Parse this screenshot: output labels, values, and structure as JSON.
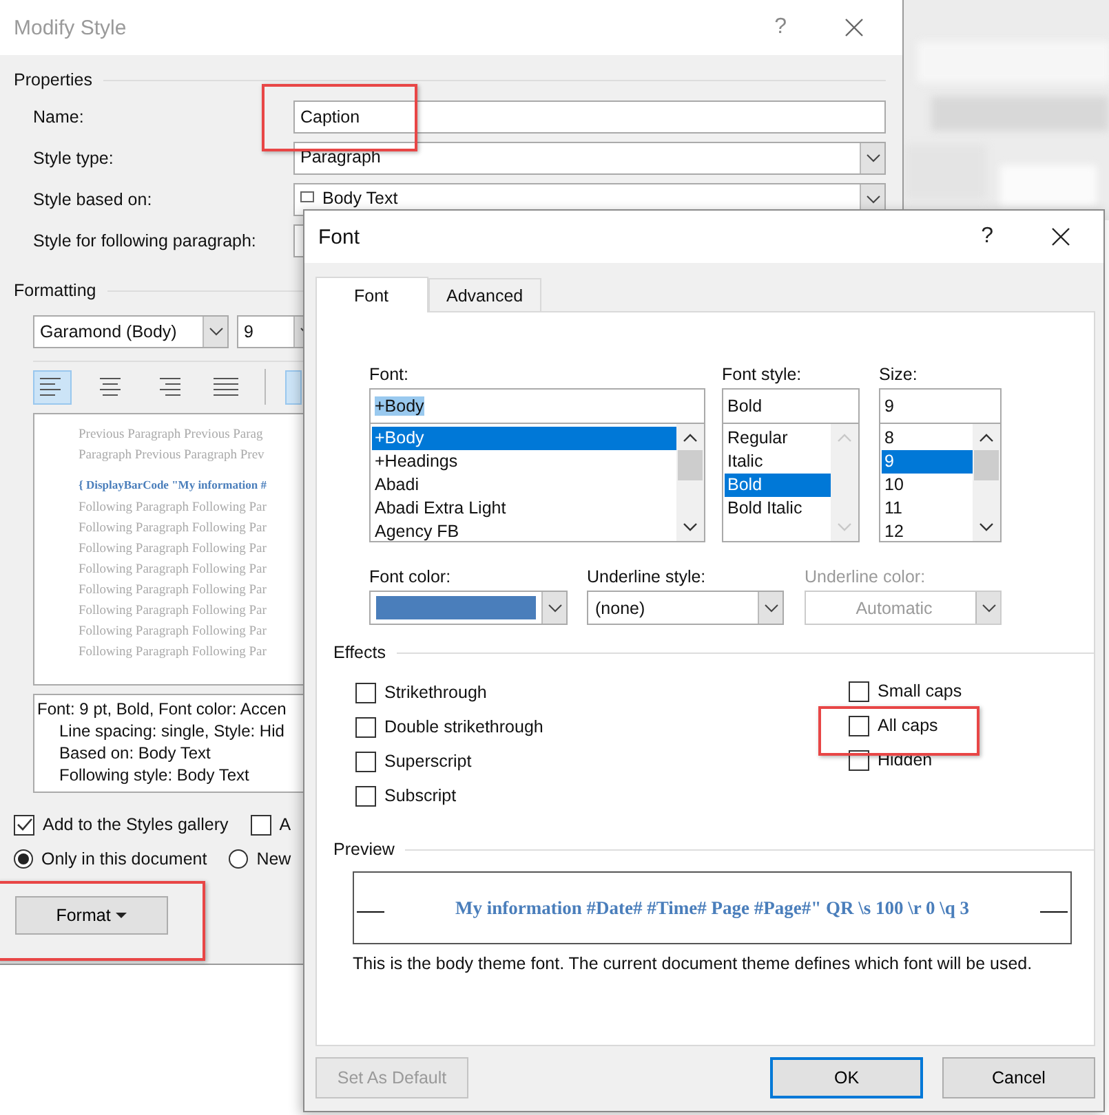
{
  "modify_style": {
    "title": "Modify Style",
    "help": "?",
    "properties": {
      "label": "Properties",
      "fields": [
        {
          "label": "Name:",
          "kind": "text",
          "value": "Caption"
        },
        {
          "label": "Style type:",
          "kind": "dropdown",
          "value": "Paragraph"
        },
        {
          "label": "Style based on:",
          "kind": "dropdown",
          "value": "Body Text"
        },
        {
          "label": "Style for following paragraph:",
          "kind": "dropdown"
        }
      ]
    },
    "formatting": {
      "label": "Formatting",
      "font": "Garamond (Body)",
      "size": "9",
      "align_buttons": [
        {
          "kind": "left",
          "selected": true
        },
        {
          "kind": "center",
          "selected": false
        },
        {
          "kind": "right",
          "selected": false
        },
        {
          "kind": "justify",
          "selected": false
        },
        {
          "kind": "cut",
          "selected": true
        }
      ]
    },
    "preview": {
      "previous_lines": [
        "Previous Paragraph Previous Parag",
        "Paragraph Previous Paragraph Prev"
      ],
      "sample": "{ DisplayBarCode \"My information #",
      "following_lines": [
        "Following Paragraph Following Par",
        "Following Paragraph Following Par",
        "Following Paragraph Following Par",
        "Following Paragraph Following Par",
        "Following Paragraph Following Par",
        "Following Paragraph Following Par",
        "Following Paragraph Following Par",
        "Following Paragraph Following Par"
      ]
    },
    "description_lines": [
      {
        "text": "Font: 9 pt, Bold, Font color: Accen",
        "indent": false
      },
      {
        "text": "Line spacing:  single, Style: Hid",
        "indent": true
      },
      {
        "text": "Based on: Body Text",
        "indent": true
      },
      {
        "text": "Following style: Body Text",
        "indent": true
      }
    ],
    "checkboxes": [
      {
        "label": "Add to the Styles gallery",
        "checked": true
      },
      {
        "label": "A",
        "checked": false
      }
    ],
    "scope": [
      {
        "label": "Only in this document",
        "selected": true
      },
      {
        "label": "New",
        "selected": false
      }
    ],
    "format_button": "Format"
  },
  "font_dialog": {
    "title": "Font",
    "help": "?",
    "tabs": [
      {
        "label": "Font",
        "selected": true
      },
      {
        "label": "Advanced",
        "selected": false
      }
    ],
    "font": {
      "label": "Font:",
      "value": "+Body",
      "items": [
        {
          "label": "+Body",
          "selected": true
        },
        {
          "label": "+Headings",
          "selected": false
        },
        {
          "label": "Abadi",
          "selected": false
        },
        {
          "label": "Abadi Extra Light",
          "selected": false
        },
        {
          "label": "Agency FB",
          "selected": false
        }
      ]
    },
    "font_style": {
      "label": "Font style:",
      "value": "Bold",
      "items": [
        {
          "label": "Regular",
          "selected": false
        },
        {
          "label": "Italic",
          "selected": false
        },
        {
          "label": "Bold",
          "selected": true
        },
        {
          "label": "Bold Italic",
          "selected": false
        }
      ]
    },
    "size": {
      "label": "Size:",
      "value": "9",
      "items": [
        {
          "label": "8",
          "selected": false
        },
        {
          "label": "9",
          "selected": true
        },
        {
          "label": "10",
          "selected": false
        },
        {
          "label": "11",
          "selected": false
        },
        {
          "label": "12",
          "selected": false
        }
      ]
    },
    "font_color": {
      "label": "Font color:",
      "color": "#4a7ebb"
    },
    "underline_style": {
      "label": "Underline style:",
      "value": "(none)",
      "disabled": false
    },
    "underline_color": {
      "label": "Underline color:",
      "value": "Automatic",
      "disabled": true
    },
    "effects": {
      "label": "Effects",
      "left": [
        {
          "label": "Strikethrough",
          "checked": false
        },
        {
          "label": "Double strikethrough",
          "checked": false
        },
        {
          "label": "Superscript",
          "checked": false
        },
        {
          "label": "Subscript",
          "checked": false
        }
      ],
      "right": [
        {
          "label": "Small caps",
          "checked": false
        },
        {
          "label": "All caps",
          "checked": false
        },
        {
          "label": "Hidden",
          "checked": false
        }
      ]
    },
    "preview": {
      "label": "Preview",
      "sample": "My information #Date# #Time# Page #Page#\" QR \\s 100 \\r 0 \\q 3",
      "note": "This is the body theme font. The current document theme defines which font will be used."
    },
    "buttons": [
      {
        "label": "Set As Default",
        "disabled": true,
        "default": false
      },
      {
        "label": "OK",
        "disabled": false,
        "default": true
      },
      {
        "label": "Cancel",
        "disabled": false,
        "default": false
      }
    ]
  }
}
